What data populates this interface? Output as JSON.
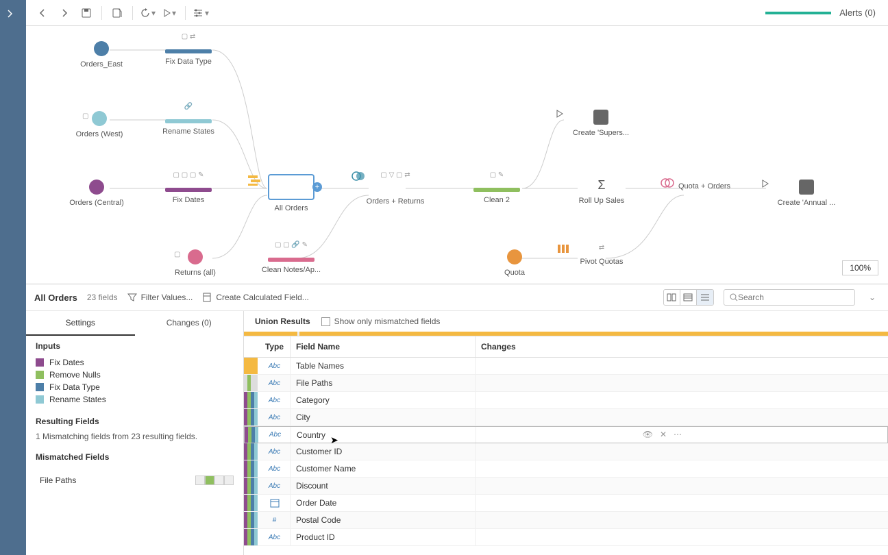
{
  "toolbar": {
    "alerts": "Alerts (0)"
  },
  "zoom": "100%",
  "nodes": {
    "orders_east": "Orders_East",
    "fix_data_type": "Fix Data Type",
    "orders_west": "Orders (West)",
    "rename_states": "Rename States",
    "orders_central": "Orders (Central)",
    "fix_dates": "Fix Dates",
    "all_orders": "All Orders",
    "orders_returns": "Orders + Returns",
    "clean2": "Clean 2",
    "roll_up": "Roll Up Sales",
    "quota_orders": "Quota + Orders",
    "create_annual": "Create 'Annual ...",
    "returns_all": "Returns (all)",
    "clean_notes": "Clean Notes/Ap...",
    "quota": "Quota",
    "pivot_quotas": "Pivot Quotas",
    "create_supers": "Create 'Supers..."
  },
  "detail": {
    "step_name": "All Orders",
    "field_count": "23 fields",
    "filter": "Filter Values...",
    "calc": "Create Calculated Field...",
    "search_placeholder": "Search"
  },
  "left": {
    "tab_settings": "Settings",
    "tab_changes": "Changes (0)",
    "inputs_title": "Inputs",
    "resulting_title": "Resulting Fields",
    "resulting_text": "1 Mismatching fields from 23 resulting fields.",
    "mismatch_title": "Mismatched Fields",
    "mismatch_item": "File Paths",
    "inputs": [
      {
        "label": "Fix Dates",
        "color": "#8e4b8e"
      },
      {
        "label": "Remove Nulls",
        "color": "#8fbf5f"
      },
      {
        "label": "Fix Data Type",
        "color": "#4d7fa8"
      },
      {
        "label": "Rename States",
        "color": "#8fc9d4"
      }
    ]
  },
  "union": {
    "title": "Union Results",
    "checkbox": "Show only mismatched fields",
    "th_type": "Type",
    "th_name": "Field Name",
    "th_changes": "Changes",
    "rows": [
      {
        "type": "Abc",
        "name": "Table Names",
        "strips": [
          "#f4b942",
          "#f4b942",
          "#f4b942",
          "#f4b942"
        ]
      },
      {
        "type": "Abc",
        "name": "File Paths",
        "strips": [
          "#ddd",
          "#8fbf5f",
          "#ddd",
          "#ddd"
        ]
      },
      {
        "type": "Abc",
        "name": "Category",
        "strips": [
          "#8e4b8e",
          "#8fbf5f",
          "#4d7fa8",
          "#8fc9d4"
        ]
      },
      {
        "type": "Abc",
        "name": "City",
        "strips": [
          "#8e4b8e",
          "#8fbf5f",
          "#4d7fa8",
          "#8fc9d4"
        ]
      },
      {
        "type": "Abc",
        "name": "Country",
        "strips": [
          "#8e4b8e",
          "#8fbf5f",
          "#4d7fa8",
          "#8fc9d4"
        ],
        "hover": true
      },
      {
        "type": "Abc",
        "name": "Customer ID",
        "strips": [
          "#8e4b8e",
          "#8fbf5f",
          "#4d7fa8",
          "#8fc9d4"
        ]
      },
      {
        "type": "Abc",
        "name": "Customer Name",
        "strips": [
          "#8e4b8e",
          "#8fbf5f",
          "#4d7fa8",
          "#8fc9d4"
        ]
      },
      {
        "type": "Abc",
        "name": "Discount",
        "strips": [
          "#8e4b8e",
          "#8fbf5f",
          "#4d7fa8",
          "#8fc9d4"
        ]
      },
      {
        "type": "date",
        "name": "Order Date",
        "strips": [
          "#8e4b8e",
          "#8fbf5f",
          "#4d7fa8",
          "#8fc9d4"
        ]
      },
      {
        "type": "#",
        "name": "Postal Code",
        "strips": [
          "#8e4b8e",
          "#8fbf5f",
          "#4d7fa8",
          "#8fc9d4"
        ]
      },
      {
        "type": "Abc",
        "name": "Product ID",
        "strips": [
          "#8e4b8e",
          "#8fbf5f",
          "#4d7fa8",
          "#8fc9d4"
        ]
      }
    ]
  },
  "colors": {
    "purple": "#8e4b8e",
    "green": "#8fbf5f",
    "blue": "#4d7fa8",
    "lightblue": "#8fc9d4",
    "pink": "#d96b8e",
    "orange": "#e8953e",
    "yellow": "#f4b942"
  }
}
